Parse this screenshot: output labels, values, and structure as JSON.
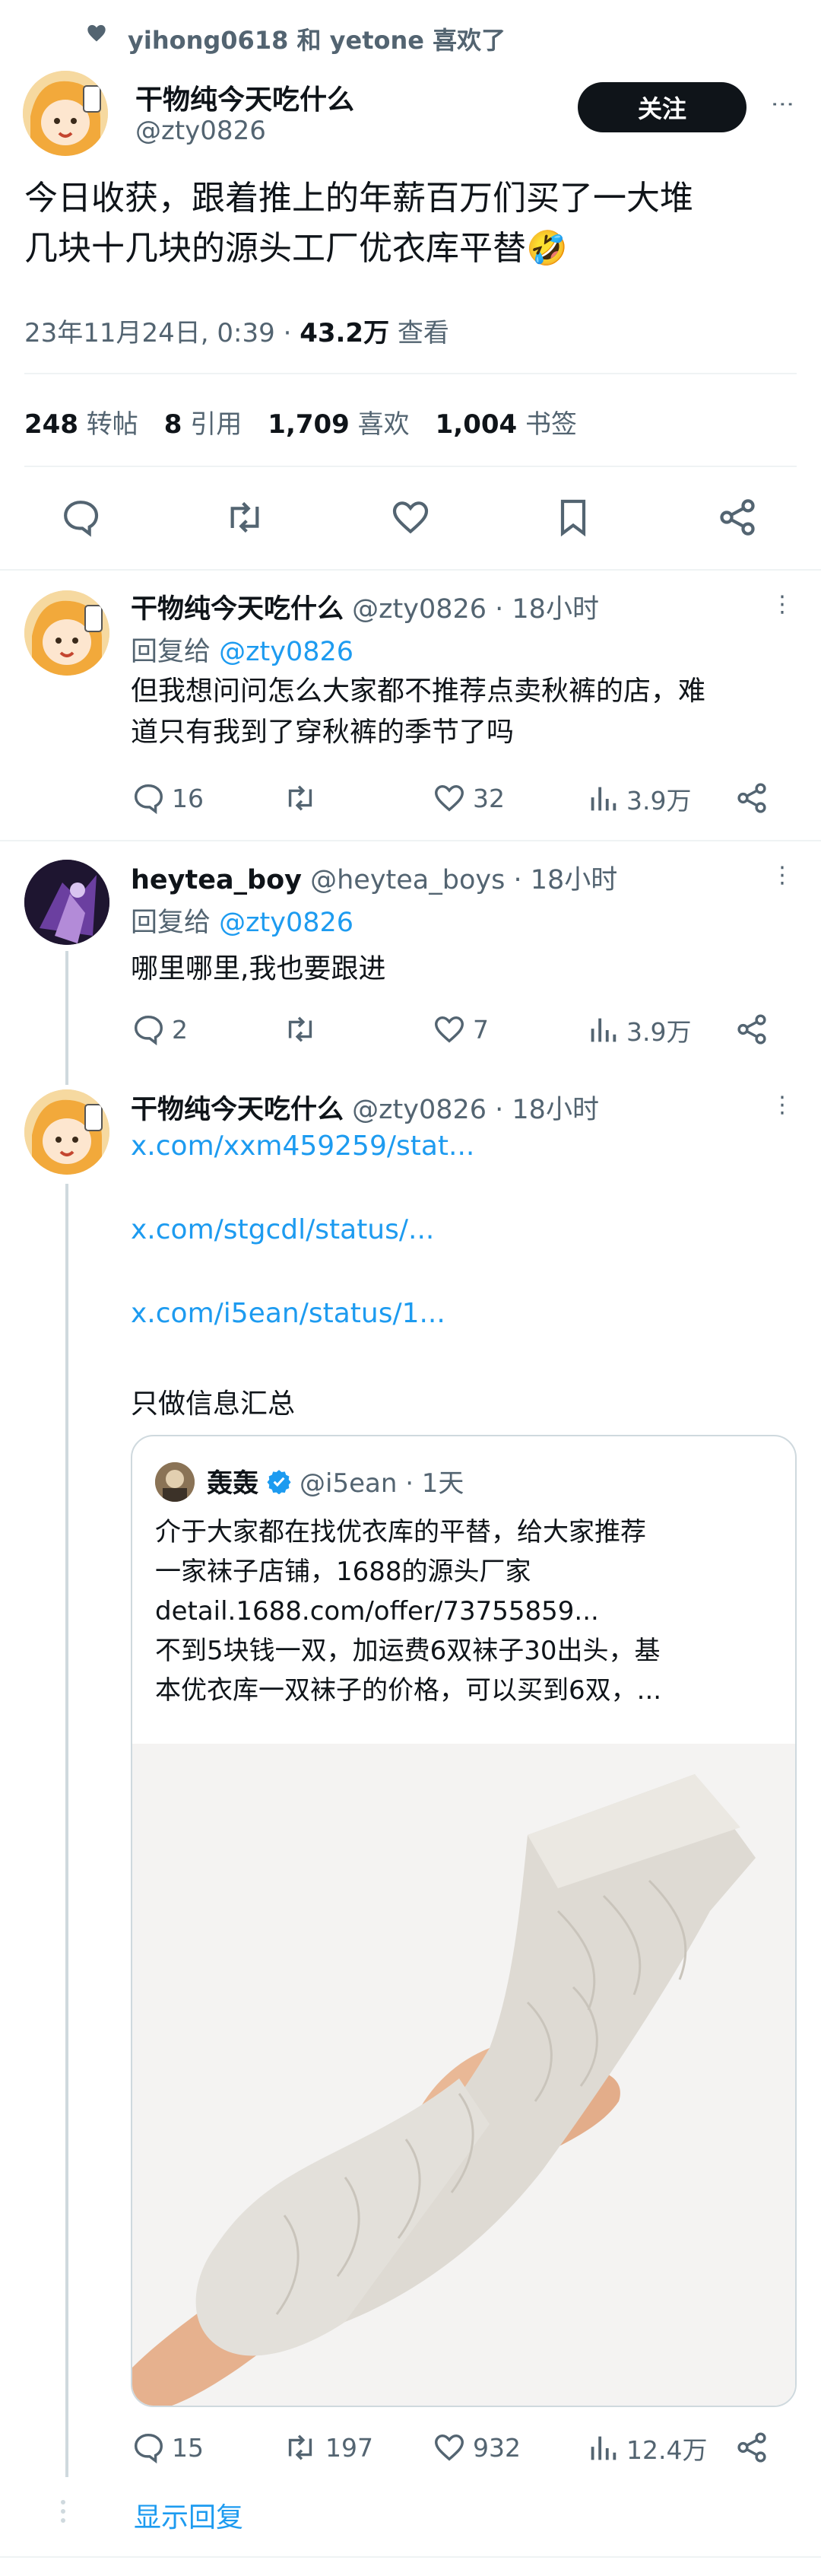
{
  "social_context": "yihong0618 和 yetone 喜欢了",
  "main": {
    "name": "干物纯今天吃什么",
    "handle": "@zty0826",
    "follow_label": "关注",
    "text_line1": "今日收获，跟着推上的年薪百万们买了一大堆",
    "text_line2": "几块十几块的源头工厂优衣库平替🤣",
    "meta_date": "23年11月24日, 0:39 · ",
    "meta_views": "43.2万",
    "meta_views_label": " 查看",
    "stats": [
      {
        "num": "248",
        "label": "转帖"
      },
      {
        "num": "8",
        "label": "引用"
      },
      {
        "num": "1,709",
        "label": "喜欢"
      },
      {
        "num": "1,004",
        "label": "书签"
      }
    ]
  },
  "replies": [
    {
      "name": "干物纯今天吃什么",
      "handle": "@zty0826 · 18小时",
      "reply_prefix": "回复给 ",
      "reply_to": "@zty0826",
      "text_line1": "但我想问问怎么大家都不推荐点卖秋裤的店，难",
      "text_line2": "道只有我到了穿秋裤的季节了吗",
      "reply_count": "16",
      "retweet_count": "",
      "like_count": "32",
      "views": "3.9万"
    },
    {
      "name": "heytea_boy",
      "handle": "@heytea_boys · 18小时",
      "reply_prefix": "回复给 ",
      "reply_to": "@zty0826",
      "text_line1": "哪里哪里,我也要跟进",
      "reply_count": "2",
      "retweet_count": "",
      "like_count": "7",
      "views": "3.9万"
    },
    {
      "name": "干物纯今天吃什么",
      "handle": "@zty0826 · 18小时",
      "link1": "x.com/xxm459259/stat...",
      "link2": "x.com/stgcdl/status/...",
      "link3": "x.com/i5ean/status/1...",
      "text": "只做信息汇总",
      "quote": {
        "name": "轰轰",
        "handle": "@i5ean · 1天",
        "line1": "介于大家都在找优衣库的平替，给大家推荐",
        "line2": "一家袜子店铺，1688的源头厂家",
        "line3": "detail.1688.com/offer/73755859...",
        "line4": "不到5块钱一双，加运费6双袜子30出头，基",
        "line5": "本优衣库一双袜子的价格，可以买到6双，..."
      },
      "reply_count": "15",
      "retweet_count": "197",
      "like_count": "932",
      "views": "12.4万"
    }
  ],
  "show_replies": "显示回复",
  "colors": {
    "accent": "#1d9bf0",
    "text": "#0f1419",
    "gray": "#536471",
    "divider": "#eff3f4"
  }
}
